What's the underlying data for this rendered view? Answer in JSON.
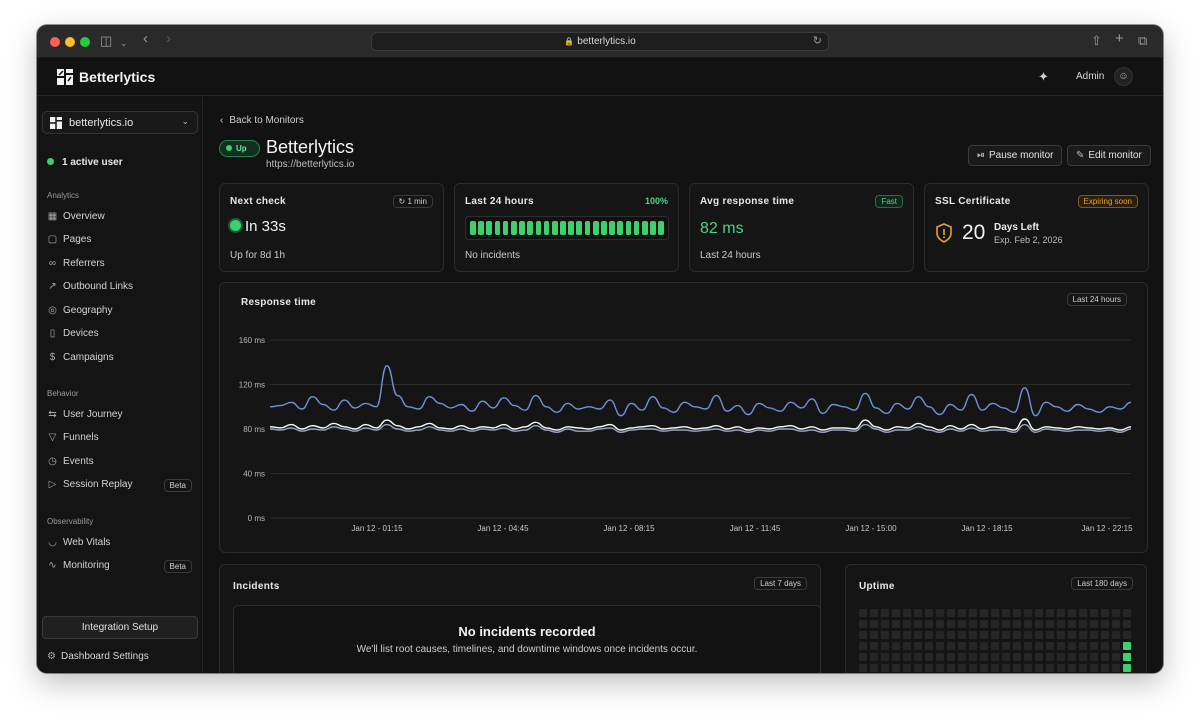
{
  "browser": {
    "url": "betterlytics.io"
  },
  "header": {
    "brand": "Betterlytics",
    "user": "Admin"
  },
  "sidebar": {
    "site": "betterlytics.io",
    "active_users": "1 active user",
    "sections": {
      "analytics": "Analytics",
      "behavior": "Behavior",
      "observability": "Observability"
    },
    "analytics_items": [
      {
        "label": "Overview",
        "icon": "grid-icon"
      },
      {
        "label": "Pages",
        "icon": "file-icon"
      },
      {
        "label": "Referrers",
        "icon": "link-icon"
      },
      {
        "label": "Outbound Links",
        "icon": "external-link-icon"
      },
      {
        "label": "Geography",
        "icon": "globe-icon"
      },
      {
        "label": "Devices",
        "icon": "device-icon"
      },
      {
        "label": "Campaigns",
        "icon": "dollar-icon"
      }
    ],
    "behavior_items": [
      {
        "label": "User Journey",
        "icon": "route-icon"
      },
      {
        "label": "Funnels",
        "icon": "funnel-icon"
      },
      {
        "label": "Events",
        "icon": "clock-icon"
      },
      {
        "label": "Session Replay",
        "icon": "video-icon",
        "badge": "Beta"
      }
    ],
    "observability_items": [
      {
        "label": "Web Vitals",
        "icon": "gauge-icon"
      },
      {
        "label": "Monitoring",
        "icon": "activity-icon",
        "badge": "Beta"
      }
    ],
    "integration": "Integration Setup",
    "settings": "Dashboard Settings"
  },
  "monitor": {
    "back": "Back to Monitors",
    "status": "Up",
    "name": "Betterlytics",
    "url": "https://betterlytics.io",
    "pause": "Pause monitor",
    "edit": "Edit monitor"
  },
  "cards": {
    "next_check": {
      "title": "Next check",
      "interval": "1 min",
      "value": "In 33s",
      "sub": "Up for 8d 1h"
    },
    "last24": {
      "title": "Last 24 hours",
      "pct": "100%",
      "sub": "No incidents",
      "bar_count": 24
    },
    "avg": {
      "title": "Avg response time",
      "badge": "Fast",
      "value": "82 ms",
      "sub": "Last 24 hours"
    },
    "ssl": {
      "title": "SSL Certificate",
      "badge": "Expiring soon",
      "days": "20",
      "days_label": "Days Left",
      "expires": "Exp. Feb 2, 2026"
    }
  },
  "chart_card": {
    "title": "Response time",
    "range": "Last 24 hours"
  },
  "chart_data": {
    "type": "line",
    "ylabel": "",
    "yticks": [
      "160 ms",
      "120 ms",
      "80 ms",
      "40 ms",
      "0 ms"
    ],
    "ylim": [
      0,
      160
    ],
    "xticks": [
      "Jan 12 - 01:15",
      "Jan 12 - 04:45",
      "Jan 12 - 08:15",
      "Jan 12 - 11:45",
      "Jan 12 - 15:00",
      "Jan 12 - 18:15",
      "Jan 12 - 22:15"
    ],
    "grid": true,
    "series": [
      {
        "color": "#6d93d9",
        "values": [
          100,
          101,
          104,
          98,
          109,
          102,
          97,
          106,
          99,
          103,
          100,
          137,
          110,
          100,
          98,
          109,
          103,
          99,
          102,
          96,
          105,
          99,
          108,
          101,
          97,
          110,
          100,
          95,
          103,
          98,
          100,
          98,
          106,
          92,
          103,
          97,
          109,
          99,
          95,
          104,
          100,
          98,
          110,
          96,
          101,
          93,
          103,
          99,
          96,
          104,
          99,
          107,
          94,
          102,
          100,
          97,
          112,
          99,
          94,
          103,
          98,
          109,
          100,
          93,
          102,
          97,
          111,
          97,
          103,
          99,
          95,
          117,
          92,
          104,
          100,
          96,
          102,
          98,
          95,
          100,
          98,
          104
        ]
      },
      {
        "color": "#ffffff",
        "values": [
          82,
          81,
          84,
          80,
          83,
          81,
          85,
          82,
          80,
          84,
          81,
          88,
          83,
          80,
          82,
          85,
          81,
          80,
          83,
          80,
          82,
          81,
          84,
          80,
          82,
          86,
          81,
          79,
          82,
          81,
          80,
          82,
          84,
          79,
          81,
          82,
          83,
          80,
          81,
          82,
          80,
          81,
          83,
          80,
          82,
          79,
          81,
          80,
          82,
          83,
          80,
          82,
          79,
          81,
          81,
          80,
          88,
          82,
          79,
          82,
          81,
          85,
          82,
          79,
          83,
          80,
          84,
          80,
          82,
          81,
          79,
          89,
          79,
          82,
          81,
          80,
          82,
          81,
          80,
          81,
          79,
          82
        ]
      },
      {
        "color": "#9aa8c6",
        "values": [
          80,
          79,
          81,
          78,
          80,
          79,
          82,
          80,
          78,
          81,
          79,
          84,
          80,
          78,
          79,
          82,
          79,
          78,
          80,
          78,
          80,
          79,
          81,
          78,
          79,
          83,
          79,
          77,
          80,
          78,
          78,
          80,
          81,
          77,
          79,
          80,
          80,
          78,
          79,
          79,
          78,
          79,
          80,
          78,
          79,
          77,
          79,
          78,
          80,
          80,
          78,
          79,
          77,
          79,
          79,
          78,
          84,
          80,
          77,
          79,
          79,
          82,
          79,
          77,
          80,
          78,
          81,
          78,
          79,
          79,
          77,
          84,
          77,
          80,
          79,
          78,
          79,
          79,
          78,
          79,
          77,
          80
        ]
      }
    ]
  },
  "incidents": {
    "title": "Incidents",
    "range": "Last 7 days",
    "empty_title": "No incidents recorded",
    "empty_text": "We'll list root causes, timelines, and downtime windows once incidents occur."
  },
  "uptime": {
    "title": "Uptime",
    "range": "Last 180 days"
  }
}
